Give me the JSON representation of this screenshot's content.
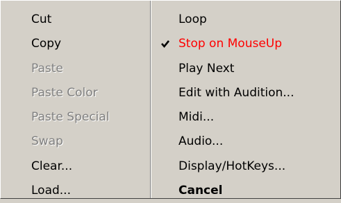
{
  "menu": {
    "left": [
      {
        "label": "Cut",
        "state": "enabled"
      },
      {
        "label": "Copy",
        "state": "enabled"
      },
      {
        "label": "Paste",
        "state": "disabled"
      },
      {
        "label": "Paste Color",
        "state": "disabled"
      },
      {
        "label": "Paste Special",
        "state": "disabled"
      },
      {
        "label": "Swap",
        "state": "disabled"
      },
      {
        "label": "Clear...",
        "state": "enabled"
      },
      {
        "label": "Load...",
        "state": "enabled"
      }
    ],
    "right": [
      {
        "label": "Loop",
        "state": "enabled"
      },
      {
        "label": "Stop on MouseUp",
        "state": "checked",
        "color": "#ff0000",
        "icon": "checkmark-icon"
      },
      {
        "label": "Play Next",
        "state": "enabled"
      },
      {
        "label": "Edit with Audition...",
        "state": "enabled"
      },
      {
        "label": "Midi...",
        "state": "enabled"
      },
      {
        "label": "Audio...",
        "state": "enabled"
      },
      {
        "label": "Display/HotKeys...",
        "state": "enabled"
      },
      {
        "label": "Cancel",
        "state": "default"
      }
    ]
  }
}
